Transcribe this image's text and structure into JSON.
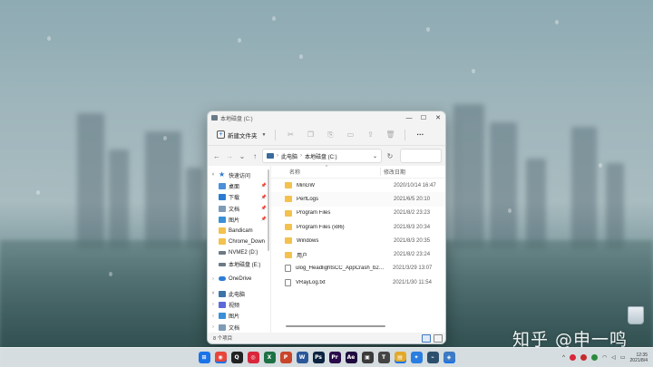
{
  "window": {
    "title": "本地磁盘 (C:)",
    "controls": {
      "minimize": "—",
      "maximize": "☐",
      "close": "✕"
    }
  },
  "commandbar": {
    "new_label": "新建文件夹",
    "more": "···"
  },
  "addressbar": {
    "back": "←",
    "forward": "→",
    "recent": "⌄",
    "up": "↑",
    "crumbs": [
      "此电脑",
      "本地磁盘 (C:)"
    ],
    "crumb_sep": "›",
    "dropdown": "⌄",
    "refresh": "↻"
  },
  "nav": {
    "items": [
      {
        "label": "快速访问",
        "icon": "star-icon",
        "expand": "˅",
        "pinned": false
      },
      {
        "label": "桌面",
        "icon": "desktop-icon",
        "expand": "",
        "pinned": true
      },
      {
        "label": "下载",
        "icon": "download-icon",
        "expand": "",
        "pinned": true
      },
      {
        "label": "文档",
        "icon": "documents-icon",
        "expand": "",
        "pinned": true
      },
      {
        "label": "图片",
        "icon": "pictures-icon",
        "expand": "",
        "pinned": true
      },
      {
        "label": "Bandicam",
        "icon": "folder-icon",
        "expand": "",
        "pinned": false
      },
      {
        "label": "Chrome_Down",
        "icon": "folder-icon",
        "expand": "",
        "pinned": false
      },
      {
        "label": "NVME2 (D:)",
        "icon": "drive-icon",
        "expand": "",
        "pinned": false
      },
      {
        "label": "本地磁盘 (E:)",
        "icon": "drive-icon",
        "expand": "",
        "pinned": false
      },
      {
        "label": "OneDrive",
        "icon": "onedrive-icon",
        "expand": "›",
        "pinned": false
      },
      {
        "label": "此电脑",
        "icon": "this-pc-icon",
        "expand": "˅",
        "pinned": false
      },
      {
        "label": "视频",
        "icon": "videos-icon",
        "expand": "›",
        "pinned": false
      },
      {
        "label": "图片",
        "icon": "pictures-icon",
        "expand": "›",
        "pinned": false
      },
      {
        "label": "文档",
        "icon": "documents-icon",
        "expand": "›",
        "pinned": false
      }
    ],
    "pin_glyph": "📌"
  },
  "files": {
    "headers": {
      "name": "名称",
      "date": "修改日期",
      "sort": "^"
    },
    "rows": [
      {
        "name": "MinGW",
        "date": "2020/10/14 16:47",
        "type": "folder"
      },
      {
        "name": "PerfLogs",
        "date": "2021/6/5 20:10",
        "type": "folder"
      },
      {
        "name": "Program Files",
        "date": "2021/8/2 23:23",
        "type": "folder"
      },
      {
        "name": "Program Files (x86)",
        "date": "2021/8/3 20:34",
        "type": "folder"
      },
      {
        "name": "Windows",
        "date": "2021/8/3 20:35",
        "type": "folder"
      },
      {
        "name": "用户",
        "date": "2021/8/2 23:24",
        "type": "folder"
      },
      {
        "name": "ulog_HeadlightsCC_AppCrash_b2d2...",
        "date": "2021/3/29 13:07",
        "type": "file"
      },
      {
        "name": "VRayLog.txt",
        "date": "2021/1/30 11:54",
        "type": "file"
      }
    ]
  },
  "status": {
    "count": "8 个项目"
  },
  "watermark": "知乎 @申一鸣",
  "taskbar": {
    "apps": [
      {
        "name": "windows-start-icon",
        "glyph": "⊞",
        "color": "#1a73e8",
        "running": false
      },
      {
        "name": "chrome-icon",
        "glyph": "◉",
        "color": "#e8453c",
        "running": true
      },
      {
        "name": "qq-icon",
        "glyph": "Q",
        "color": "#222222",
        "running": false
      },
      {
        "name": "netease-music-icon",
        "glyph": "◎",
        "color": "#d9263b",
        "running": false
      },
      {
        "name": "excel-icon",
        "glyph": "X",
        "color": "#1e7145",
        "running": false
      },
      {
        "name": "powerpoint-icon",
        "glyph": "P",
        "color": "#c9452a",
        "running": false
      },
      {
        "name": "word-icon",
        "glyph": "W",
        "color": "#2b579a",
        "running": false
      },
      {
        "name": "photoshop-icon",
        "glyph": "Ps",
        "color": "#0b2340",
        "running": false
      },
      {
        "name": "premiere-icon",
        "glyph": "Pr",
        "color": "#2a0a4a",
        "running": false
      },
      {
        "name": "after-effects-icon",
        "glyph": "Ae",
        "color": "#1f0a3f",
        "running": false
      },
      {
        "name": "image-viewer-icon",
        "glyph": "▣",
        "color": "#3b3b3b",
        "running": false
      },
      {
        "name": "typora-icon",
        "glyph": "T",
        "color": "#444444",
        "running": false
      },
      {
        "name": "file-explorer-icon",
        "glyph": "▤",
        "color": "#e2a92b",
        "running": true
      },
      {
        "name": "app-pin-icon",
        "glyph": "✦",
        "color": "#2a7de1",
        "running": false
      },
      {
        "name": "scanner-icon",
        "glyph": "⌁",
        "color": "#2d4f6e",
        "running": false
      },
      {
        "name": "settings-app-icon",
        "glyph": "◈",
        "color": "#3d7bc4",
        "running": true
      }
    ],
    "tray": {
      "chevron": "^",
      "time": "12:35",
      "date": "2021/8/4"
    }
  },
  "colors": {
    "accent": "#1a73e8",
    "folder": "#f2c14e"
  }
}
